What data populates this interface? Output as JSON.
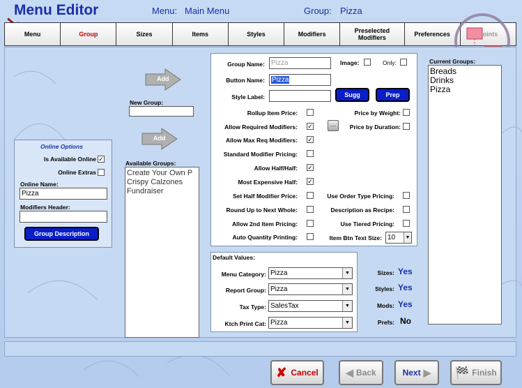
{
  "header": {
    "title": "Menu Editor",
    "menu_label": "Menu:",
    "menu_value": "Main Menu",
    "group_label": "Group:",
    "group_value": "Pizza"
  },
  "tabs": [
    {
      "label": "Menu",
      "state": "normal"
    },
    {
      "label": "Group",
      "state": "active"
    },
    {
      "label": "Sizes",
      "state": "normal"
    },
    {
      "label": "Items",
      "state": "normal"
    },
    {
      "label": "Styles",
      "state": "normal"
    },
    {
      "label": "Modifiers",
      "state": "normal"
    },
    {
      "label": "Preselected Modifiers",
      "state": "normal"
    },
    {
      "label": "Preferences",
      "state": "normal"
    },
    {
      "label": "Points",
      "state": "disabled"
    }
  ],
  "online_options": {
    "title": "Online Options",
    "is_available_online_label": "Is Available Online",
    "is_available_online_checked": true,
    "online_extras_label": "Online Extras",
    "online_extras_checked": false,
    "online_name_label": "Online Name:",
    "online_name_value": "Pizza",
    "modifiers_header_label": "Modifiers Header:",
    "modifiers_header_value": "",
    "group_description_button": "Group Description"
  },
  "new_group": {
    "add_label": "Add",
    "label": "New Group:",
    "value": ""
  },
  "available_groups": {
    "add_label": "Add",
    "label": "Available Groups:",
    "items": [
      "Create Your Own P",
      "Crispy Calzones",
      "Fundraiser"
    ]
  },
  "group_form": {
    "group_name_label": "Group Name:",
    "group_name_value": "Pizza",
    "image_label": "Image:",
    "only_label": "Only:",
    "button_name_label": "Button Name:",
    "button_name_value": "Pizza",
    "style_label_label": "Style Label:",
    "style_label_value": "",
    "sugg_button": "Sugg",
    "prep_button": "Prep",
    "left_options": [
      {
        "label": "Rollup Item Price:",
        "checked": false
      },
      {
        "label": "Allow Required Modifiers:",
        "checked": true
      },
      {
        "label": "Allow Max Req Modifiers:",
        "checked": true
      },
      {
        "label": "Standard Modifier Pricing:",
        "checked": false
      },
      {
        "label": "Allow Half/Half:",
        "checked": true
      },
      {
        "label": "Most Expensive Half:",
        "checked": true
      },
      {
        "label": "Set Half Modifier Price:",
        "checked": false
      },
      {
        "label": "Round Up to Next Whole:",
        "checked": false
      },
      {
        "label": "Allow 2nd Item Pricing:",
        "checked": false
      },
      {
        "label": "Auto Quantity Printing:",
        "checked": false
      }
    ],
    "price_by_weight_label": "Price by Weight:",
    "price_by_duration_label": "Price by Duration:",
    "right_options": [
      {
        "label": "Use Order Type Pricing:",
        "checked": false
      },
      {
        "label": "Description as Recipe:",
        "checked": false
      },
      {
        "label": "Use Tiered Pricing:",
        "checked": false
      }
    ],
    "item_btn_text_size_label": "Item Btn Text Size:",
    "item_btn_text_size_value": "10"
  },
  "default_values": {
    "title": "Default Values:",
    "menu_category_label": "Menu Category:",
    "menu_category_value": "Pizza",
    "report_group_label": "Report Group:",
    "report_group_value": "Pizza",
    "tax_type_label": "Tax Type:",
    "tax_type_value": "SalesTax",
    "ktch_print_cat_label": "Ktch Print Cat:",
    "ktch_print_cat_value": "Pizza"
  },
  "summary": {
    "sizes_label": "Sizes:",
    "sizes_value": "Yes",
    "styles_label": "Styles:",
    "styles_value": "Yes",
    "mods_label": "Mods:",
    "mods_value": "Yes",
    "prefs_label": "Prefs:",
    "prefs_value": "No"
  },
  "current_groups": {
    "label": "Current Groups:",
    "items": [
      "Breads",
      "Drinks",
      "Pizza"
    ]
  },
  "nav": {
    "cancel": "Cancel",
    "back": "Back",
    "next": "Next",
    "finish": "Finish"
  },
  "colors": {
    "accent_blue": "#0a1ec8",
    "title_blue": "#1a2fa8",
    "active_red": "#c00000"
  }
}
